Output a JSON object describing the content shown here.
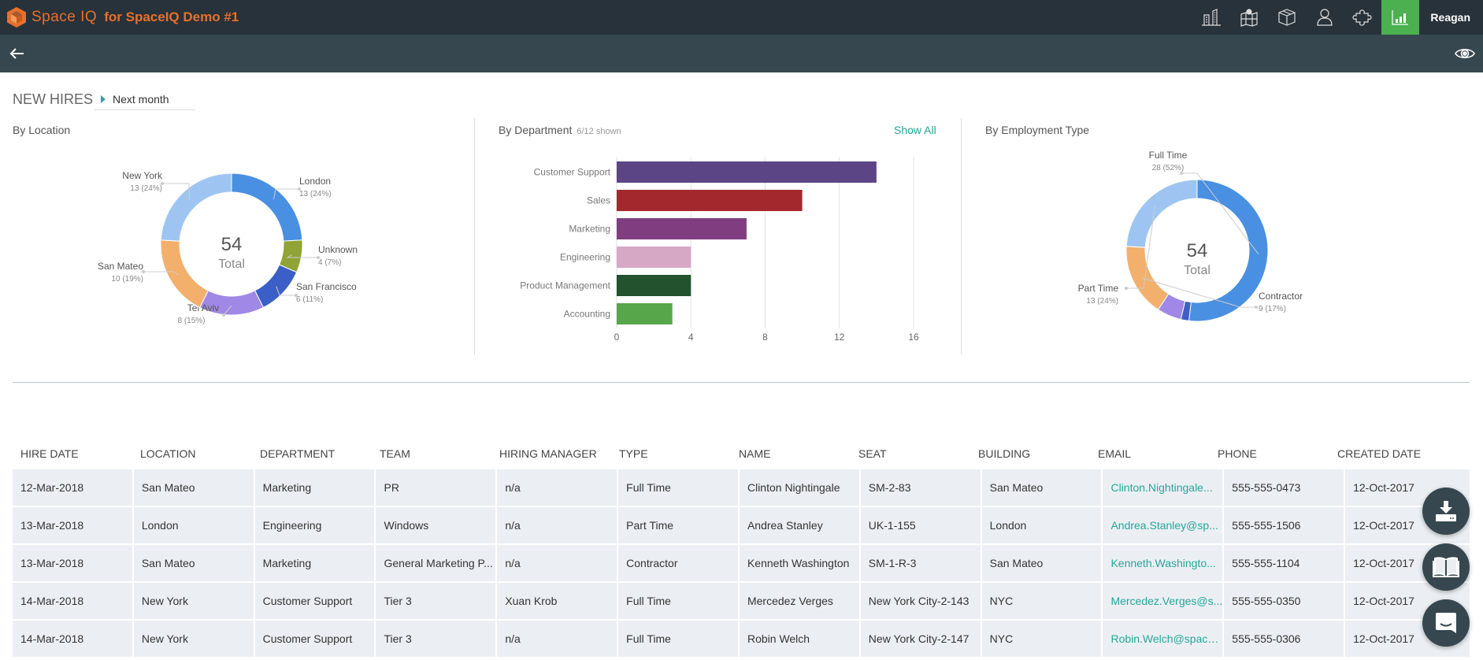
{
  "app": {
    "brand_name": "Space IQ",
    "brand_for": "for SpaceIQ Demo #1",
    "user_name": "Reagan",
    "nav_icons": [
      "buildings-icon",
      "map-icon",
      "box-icon",
      "person-icon",
      "puzzle-icon",
      "chart-icon"
    ],
    "active_nav": "chart-icon",
    "accent_color": "#26a69a",
    "brand_color": "#e8702a",
    "active_color": "#4caf50"
  },
  "page": {
    "title": "NEW HIRES",
    "period": "Next month"
  },
  "panels": {
    "location": {
      "title": "By Location"
    },
    "department": {
      "title": "By Department",
      "subtitle": "6/12 shown",
      "show_all": "Show All"
    },
    "employment": {
      "title": "By Employment Type"
    }
  },
  "chart_data": [
    {
      "type": "pie",
      "title": "By Location",
      "center_value": "54",
      "center_label": "Total",
      "slices": [
        {
          "label": "London",
          "value": 13,
          "text": "13 (24%)",
          "color": "#4a90e2"
        },
        {
          "label": "Unknown",
          "value": 4,
          "text": "4 (7%)",
          "color": "#8fa336"
        },
        {
          "label": "San Francisco",
          "value": 6,
          "text": "6 (11%)",
          "color": "#3b5fc6"
        },
        {
          "label": "Tel Aviv",
          "value": 8,
          "text": "8 (15%)",
          "color": "#a088e6"
        },
        {
          "label": "San Mateo",
          "value": 10,
          "text": "10 (19%)",
          "color": "#f2b06c"
        },
        {
          "label": "New York",
          "value": 13,
          "text": "13 (24%)",
          "color": "#9ec5f2"
        }
      ]
    },
    {
      "type": "bar",
      "title": "By Department",
      "categories": [
        "Customer Support",
        "Sales",
        "Marketing",
        "Engineering",
        "Product Management",
        "Accounting"
      ],
      "values": [
        14,
        10,
        7,
        4,
        4,
        3
      ],
      "colors": [
        "#5c4585",
        "#a3282e",
        "#803d80",
        "#d6a8c6",
        "#22522e",
        "#58a64a"
      ],
      "xticks": [
        "0",
        "4",
        "8",
        "12",
        "16"
      ],
      "xlim": [
        0,
        16
      ],
      "orientation": "horizontal",
      "grid": true
    },
    {
      "type": "pie",
      "title": "By Employment Type",
      "center_value": "54",
      "center_label": "Total",
      "slices": [
        {
          "label": "Full Time",
          "value": 28,
          "text": "28 (52%)",
          "color": "#4a90e2"
        },
        {
          "label": "",
          "value": 1,
          "text": "",
          "color": "#3b5fc6"
        },
        {
          "label": "",
          "value": 3,
          "text": "",
          "color": "#a088e6"
        },
        {
          "label": "Contractor",
          "value": 9,
          "text": "9 (17%)",
          "color": "#f2b06c"
        },
        {
          "label": "Part Time",
          "value": 13,
          "text": "13 (24%)",
          "color": "#9ec5f2"
        }
      ]
    }
  ],
  "table": {
    "columns": [
      "HIRE DATE",
      "LOCATION",
      "DEPARTMENT",
      "TEAM",
      "HIRING MANAGER",
      "TYPE",
      "NAME",
      "SEAT",
      "BUILDING",
      "EMAIL",
      "PHONE",
      "CREATED DATE"
    ],
    "rows": [
      [
        "12-Mar-2018",
        "San Mateo",
        "Marketing",
        "PR",
        "n/a",
        "Full Time",
        "Clinton Nightingale",
        "SM-2-83",
        "San Mateo",
        "Clinton.Nightingale...",
        "555-555-0473",
        "12-Oct-2017"
      ],
      [
        "13-Mar-2018",
        "London",
        "Engineering",
        "Windows",
        "n/a",
        "Part Time",
        "Andrea Stanley",
        "UK-1-155",
        "London",
        "Andrea.Stanley@sp...",
        "555-555-1506",
        "12-Oct-2017"
      ],
      [
        "13-Mar-2018",
        "San Mateo",
        "Marketing",
        "General Marketing P...",
        "n/a",
        "Contractor",
        "Kenneth Washington",
        "SM-1-R-3",
        "San Mateo",
        "Kenneth.Washingto...",
        "555-555-1104",
        "12-Oct-2017"
      ],
      [
        "14-Mar-2018",
        "New York",
        "Customer Support",
        "Tier 3",
        "Xuan Krob",
        "Full Time",
        "Mercedez Verges",
        "New York City-2-143",
        "NYC",
        "Mercedez.Verges@s...",
        "555-555-0350",
        "12-Oct-2017"
      ],
      [
        "14-Mar-2018",
        "New York",
        "Customer Support",
        "Tier 3",
        "n/a",
        "Full Time",
        "Robin Welch",
        "New York City-2-147",
        "NYC",
        "Robin.Welch@space...",
        "555-555-0306",
        "12-Oct-2017"
      ]
    ]
  },
  "fabs": [
    "download-icon",
    "book-icon",
    "chat-icon"
  ]
}
